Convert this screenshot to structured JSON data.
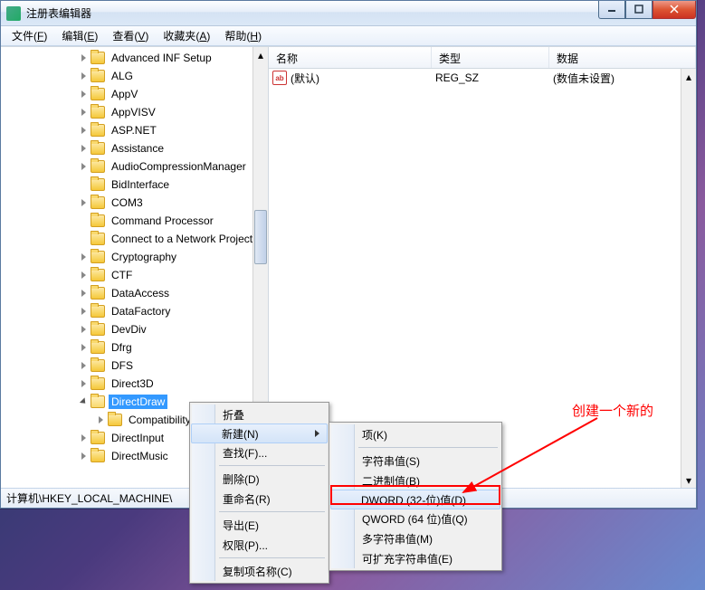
{
  "window": {
    "title": "注册表编辑器"
  },
  "menubar": [
    {
      "label": "文件",
      "key": "F"
    },
    {
      "label": "编辑",
      "key": "E"
    },
    {
      "label": "查看",
      "key": "V"
    },
    {
      "label": "收藏夹",
      "key": "A"
    },
    {
      "label": "帮助",
      "key": "H"
    }
  ],
  "tree": [
    {
      "label": "Advanced INF Setup",
      "expander": true
    },
    {
      "label": "ALG",
      "expander": true
    },
    {
      "label": "AppV",
      "expander": true
    },
    {
      "label": "AppVISV",
      "expander": true
    },
    {
      "label": "ASP.NET",
      "expander": true
    },
    {
      "label": "Assistance",
      "expander": true
    },
    {
      "label": "AudioCompressionManager",
      "expander": true
    },
    {
      "label": "BidInterface",
      "expander": false
    },
    {
      "label": "COM3",
      "expander": true
    },
    {
      "label": "Command Processor",
      "expander": false
    },
    {
      "label": "Connect to a Network Projector",
      "expander": false
    },
    {
      "label": "Cryptography",
      "expander": true
    },
    {
      "label": "CTF",
      "expander": true
    },
    {
      "label": "DataAccess",
      "expander": true
    },
    {
      "label": "DataFactory",
      "expander": true
    },
    {
      "label": "DevDiv",
      "expander": true
    },
    {
      "label": "Dfrg",
      "expander": true
    },
    {
      "label": "DFS",
      "expander": true
    },
    {
      "label": "Direct3D",
      "expander": true
    },
    {
      "label": "DirectDraw",
      "expander": true,
      "open": true,
      "selected": true
    },
    {
      "label": "Compatibility",
      "expander": true,
      "level": 1
    },
    {
      "label": "DirectInput",
      "expander": true
    },
    {
      "label": "DirectMusic",
      "expander": true
    }
  ],
  "list": {
    "headers": {
      "name": "名称",
      "type": "类型",
      "data": "数据"
    },
    "rows": [
      {
        "icon": "ab",
        "name": "(默认)",
        "type": "REG_SZ",
        "data": "(数值未设置)"
      }
    ]
  },
  "statusbar": "计算机\\HKEY_LOCAL_MACHINE\\",
  "context_menu_1": [
    {
      "label": "折叠",
      "type": "item"
    },
    {
      "label": "新建(N)",
      "type": "item",
      "submenu": true,
      "highlight": true
    },
    {
      "label": "查找(F)...",
      "type": "item"
    },
    {
      "type": "sep"
    },
    {
      "label": "删除(D)",
      "type": "item"
    },
    {
      "label": "重命名(R)",
      "type": "item"
    },
    {
      "type": "sep"
    },
    {
      "label": "导出(E)",
      "type": "item"
    },
    {
      "label": "权限(P)...",
      "type": "item"
    },
    {
      "type": "sep"
    },
    {
      "label": "复制项名称(C)",
      "type": "item"
    }
  ],
  "context_menu_2": [
    {
      "label": "项(K)",
      "type": "item"
    },
    {
      "type": "sep"
    },
    {
      "label": "字符串值(S)",
      "type": "item"
    },
    {
      "label": "二进制值(B)",
      "type": "item"
    },
    {
      "label": "DWORD (32-位)值(D)",
      "type": "item",
      "highlight": true
    },
    {
      "label": "QWORD (64 位)值(Q)",
      "type": "item"
    },
    {
      "label": "多字符串值(M)",
      "type": "item"
    },
    {
      "label": "可扩充字符串值(E)",
      "type": "item"
    }
  ],
  "annotation": "创建一个新的"
}
